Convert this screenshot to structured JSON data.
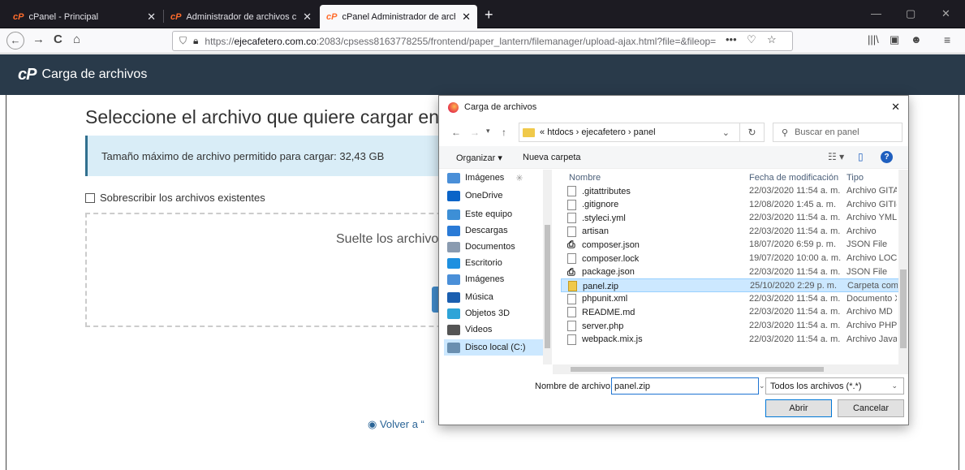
{
  "browser": {
    "tabs": [
      {
        "label": "cPanel - Principal",
        "close": "✕"
      },
      {
        "label": "Administrador de archivos cPa",
        "close": "✕"
      },
      {
        "label": "cPanel Administrador de archi",
        "close": "✕"
      }
    ],
    "new_tab": "+",
    "window_controls": {
      "min": "—",
      "max": "▢",
      "close": "✕"
    },
    "url_prefix": "https://",
    "url_domain": "ejecafetero.com.co",
    "url_rest": ":2083/cpsess8163778255/frontend/paper_lantern/filemanager/upload-ajax.html?file=&fileop=",
    "page_actions": "•••",
    "nav": {
      "back": "←",
      "forward": "→",
      "reload": "C",
      "home": "⌂"
    }
  },
  "cpanel": {
    "logo": "cP",
    "header_title": "Carga de archivos",
    "page_title": "Seleccione el archivo que quiere cargar en “/h",
    "max_size_text": "Tamaño máximo de archivo permitido para cargar: 32,43 GB",
    "overwrite_label": "Sobrescribir los archivos existentes",
    "drop_text": "Suelte los archivos",
    "back_link": "Volver a “"
  },
  "dialog": {
    "title": "Carga de archivos",
    "close": "✕",
    "breadcrumb": [
      "«",
      "htdocs",
      "›",
      "ejecafetero",
      "›",
      "panel"
    ],
    "search_placeholder": "Buscar en panel",
    "organize": "Organizar ▾",
    "new_folder": "Nueva carpeta",
    "help": "?",
    "nav_items": [
      {
        "label": "Imágenes",
        "icon": "pictures-icon",
        "color": "#4a8fd8"
      },
      {
        "label": "OneDrive",
        "icon": "onedrive-icon",
        "color": "#0a64c8"
      },
      {
        "label": "Este equipo",
        "icon": "computer-icon",
        "color": "#3d8fd6"
      },
      {
        "label": "Descargas",
        "icon": "download-icon",
        "color": "#2a7ad6"
      },
      {
        "label": "Documentos",
        "icon": "documents-icon",
        "color": "#8a9bb0"
      },
      {
        "label": "Escritorio",
        "icon": "desktop-icon",
        "color": "#1e90e0"
      },
      {
        "label": "Imágenes",
        "icon": "pictures-icon",
        "color": "#4a8fd8"
      },
      {
        "label": "Música",
        "icon": "music-icon",
        "color": "#1b5fb0"
      },
      {
        "label": "Objetos 3D",
        "icon": "objects3d-icon",
        "color": "#2ea4d8"
      },
      {
        "label": "Videos",
        "icon": "videos-icon",
        "color": "#555555"
      },
      {
        "label": "Disco local (C:)",
        "icon": "disk-icon",
        "color": "#6a8fb0"
      }
    ],
    "columns": {
      "name": "Nombre",
      "date": "Fecha de modificación",
      "type": "Tipo"
    },
    "files": [
      {
        "name": ".gitattributes",
        "date": "22/03/2020 11:54 a. m.",
        "type": "Archivo GITA",
        "icon": "file"
      },
      {
        "name": ".gitignore",
        "date": "12/08/2020 1:45 a. m.",
        "type": "Archivo GITI(",
        "icon": "file"
      },
      {
        "name": ".styleci.yml",
        "date": "22/03/2020 11:54 a. m.",
        "type": "Archivo YML",
        "icon": "file"
      },
      {
        "name": "artisan",
        "date": "22/03/2020 11:54 a. m.",
        "type": "Archivo",
        "icon": "file"
      },
      {
        "name": "composer.json",
        "date": "18/07/2020 6:59 p. m.",
        "type": "JSON File",
        "icon": "json"
      },
      {
        "name": "composer.lock",
        "date": "19/07/2020 10:00 a. m.",
        "type": "Archivo LOC",
        "icon": "file"
      },
      {
        "name": "package.json",
        "date": "22/03/2020 11:54 a. m.",
        "type": "JSON File",
        "icon": "json"
      },
      {
        "name": "panel.zip",
        "date": "25/10/2020 2:29 p. m.",
        "type": "Carpeta com",
        "icon": "zip"
      },
      {
        "name": "phpunit.xml",
        "date": "22/03/2020 11:54 a. m.",
        "type": "Documento X",
        "icon": "file"
      },
      {
        "name": "README.md",
        "date": "22/03/2020 11:54 a. m.",
        "type": "Archivo MD",
        "icon": "file"
      },
      {
        "name": "server.php",
        "date": "22/03/2020 11:54 a. m.",
        "type": "Archivo PHP",
        "icon": "file"
      },
      {
        "name": "webpack.mix.js",
        "date": "22/03/2020 11:54 a. m.",
        "type": "Archivo JavaS",
        "icon": "file"
      }
    ],
    "filename_label": "Nombre de archivo:",
    "filename_value": "panel.zip",
    "filetype_value": "Todos los archivos (*.*)",
    "open_button": "Abrir",
    "cancel_button": "Cancelar"
  }
}
